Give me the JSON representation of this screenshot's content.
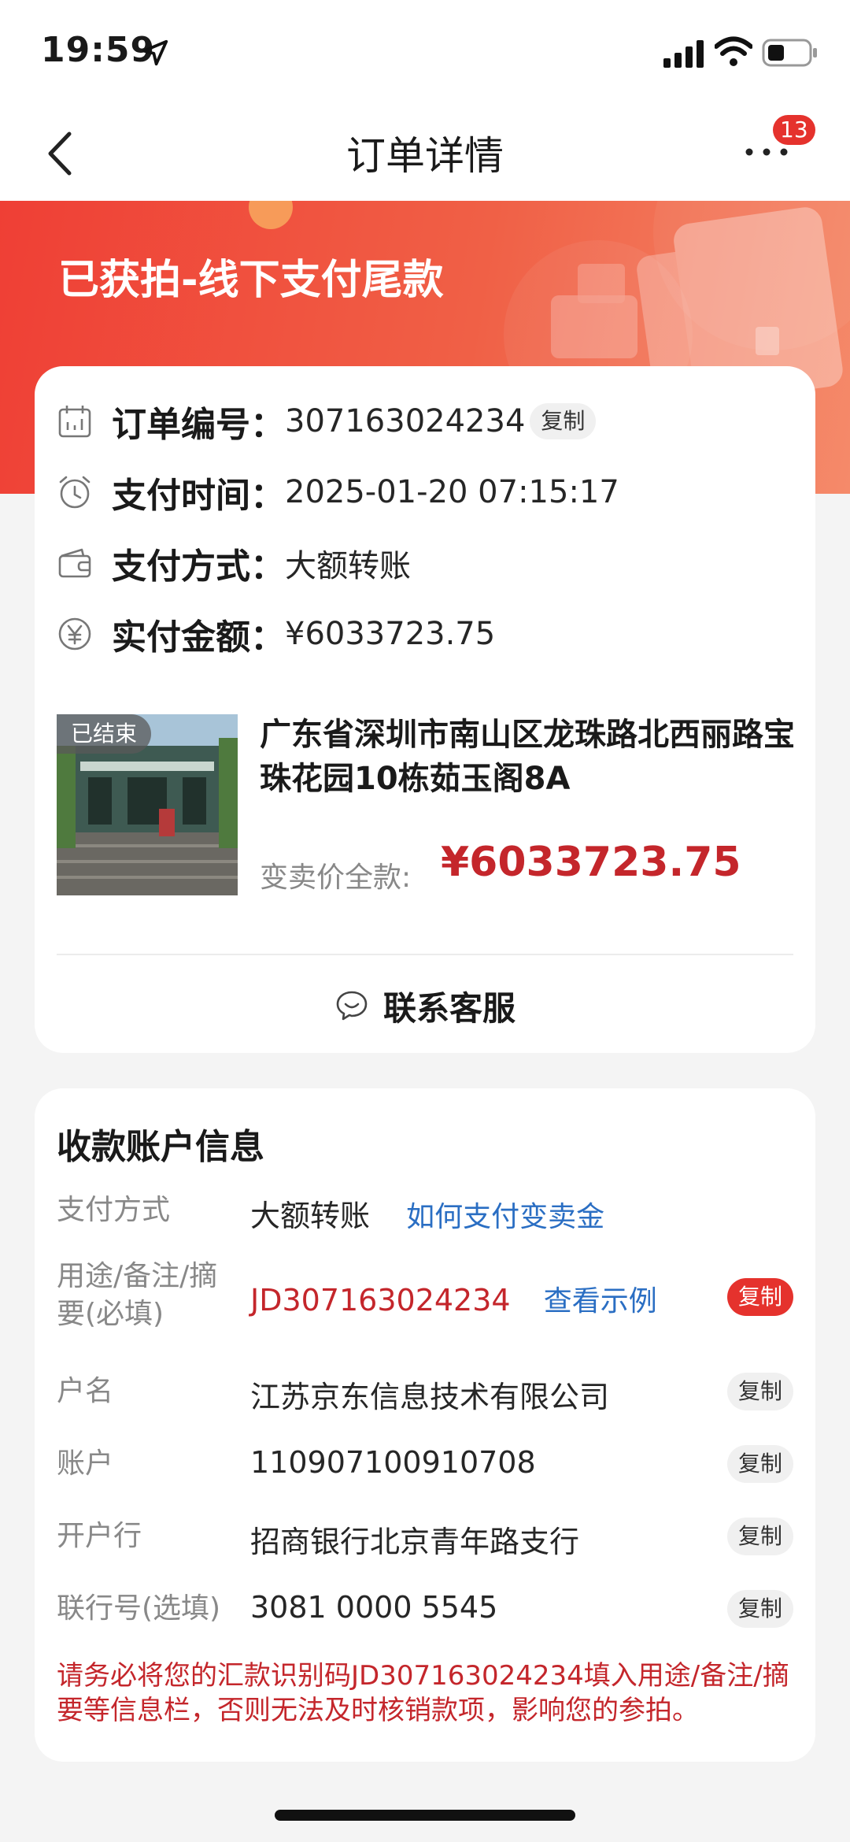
{
  "status_bar": {
    "time": "19:59"
  },
  "nav": {
    "title": "订单详情",
    "badge_count": "13"
  },
  "banner": {
    "title": "已获拍-线下支付尾款"
  },
  "order": {
    "rows": [
      {
        "label": "订单编号：",
        "value": "307163024234",
        "copy": "复制"
      },
      {
        "label": "支付时间：",
        "value": "2025-01-20 07:15:17"
      },
      {
        "label": "支付方式：",
        "value": "大额转账"
      },
      {
        "label": "实付金额：",
        "value": "¥6033723.75"
      }
    ],
    "item": {
      "tag": "已结束",
      "address": "广东省深圳市南山区龙珠路北西丽路宝珠花园10栋茹玉阁8A",
      "price_label": "变卖价全款:",
      "price_value": "¥6033723.75"
    },
    "contact_label": "联系客服"
  },
  "account": {
    "title": "收款账户信息",
    "rows": [
      {
        "label": "支付方式",
        "value": "大额转账",
        "link": "如何支付变卖金"
      },
      {
        "label": "用途/备注/摘要(必填)",
        "value": "JD307163024234",
        "link": "查看示例",
        "copy": "复制"
      },
      {
        "label": "户名",
        "value": "江苏京东信息技术有限公司",
        "copy": "复制"
      },
      {
        "label": "账户",
        "value": "110907100910708",
        "copy": "复制"
      },
      {
        "label": "开户行",
        "value": "招商银行北京青年路支行",
        "copy": "复制"
      },
      {
        "label": "联行号(选填)",
        "value": "3081 0000 5545",
        "copy": "复制"
      }
    ],
    "notice": "请务必将您的汇款识别码JD307163024234填入用途/备注/摘要等信息栏，否则无法及时核销款项，影响您的参拍。"
  },
  "colors": {
    "accent_red": "#e5322d",
    "price_red": "#c4262b",
    "link_blue": "#2a6ec3"
  }
}
